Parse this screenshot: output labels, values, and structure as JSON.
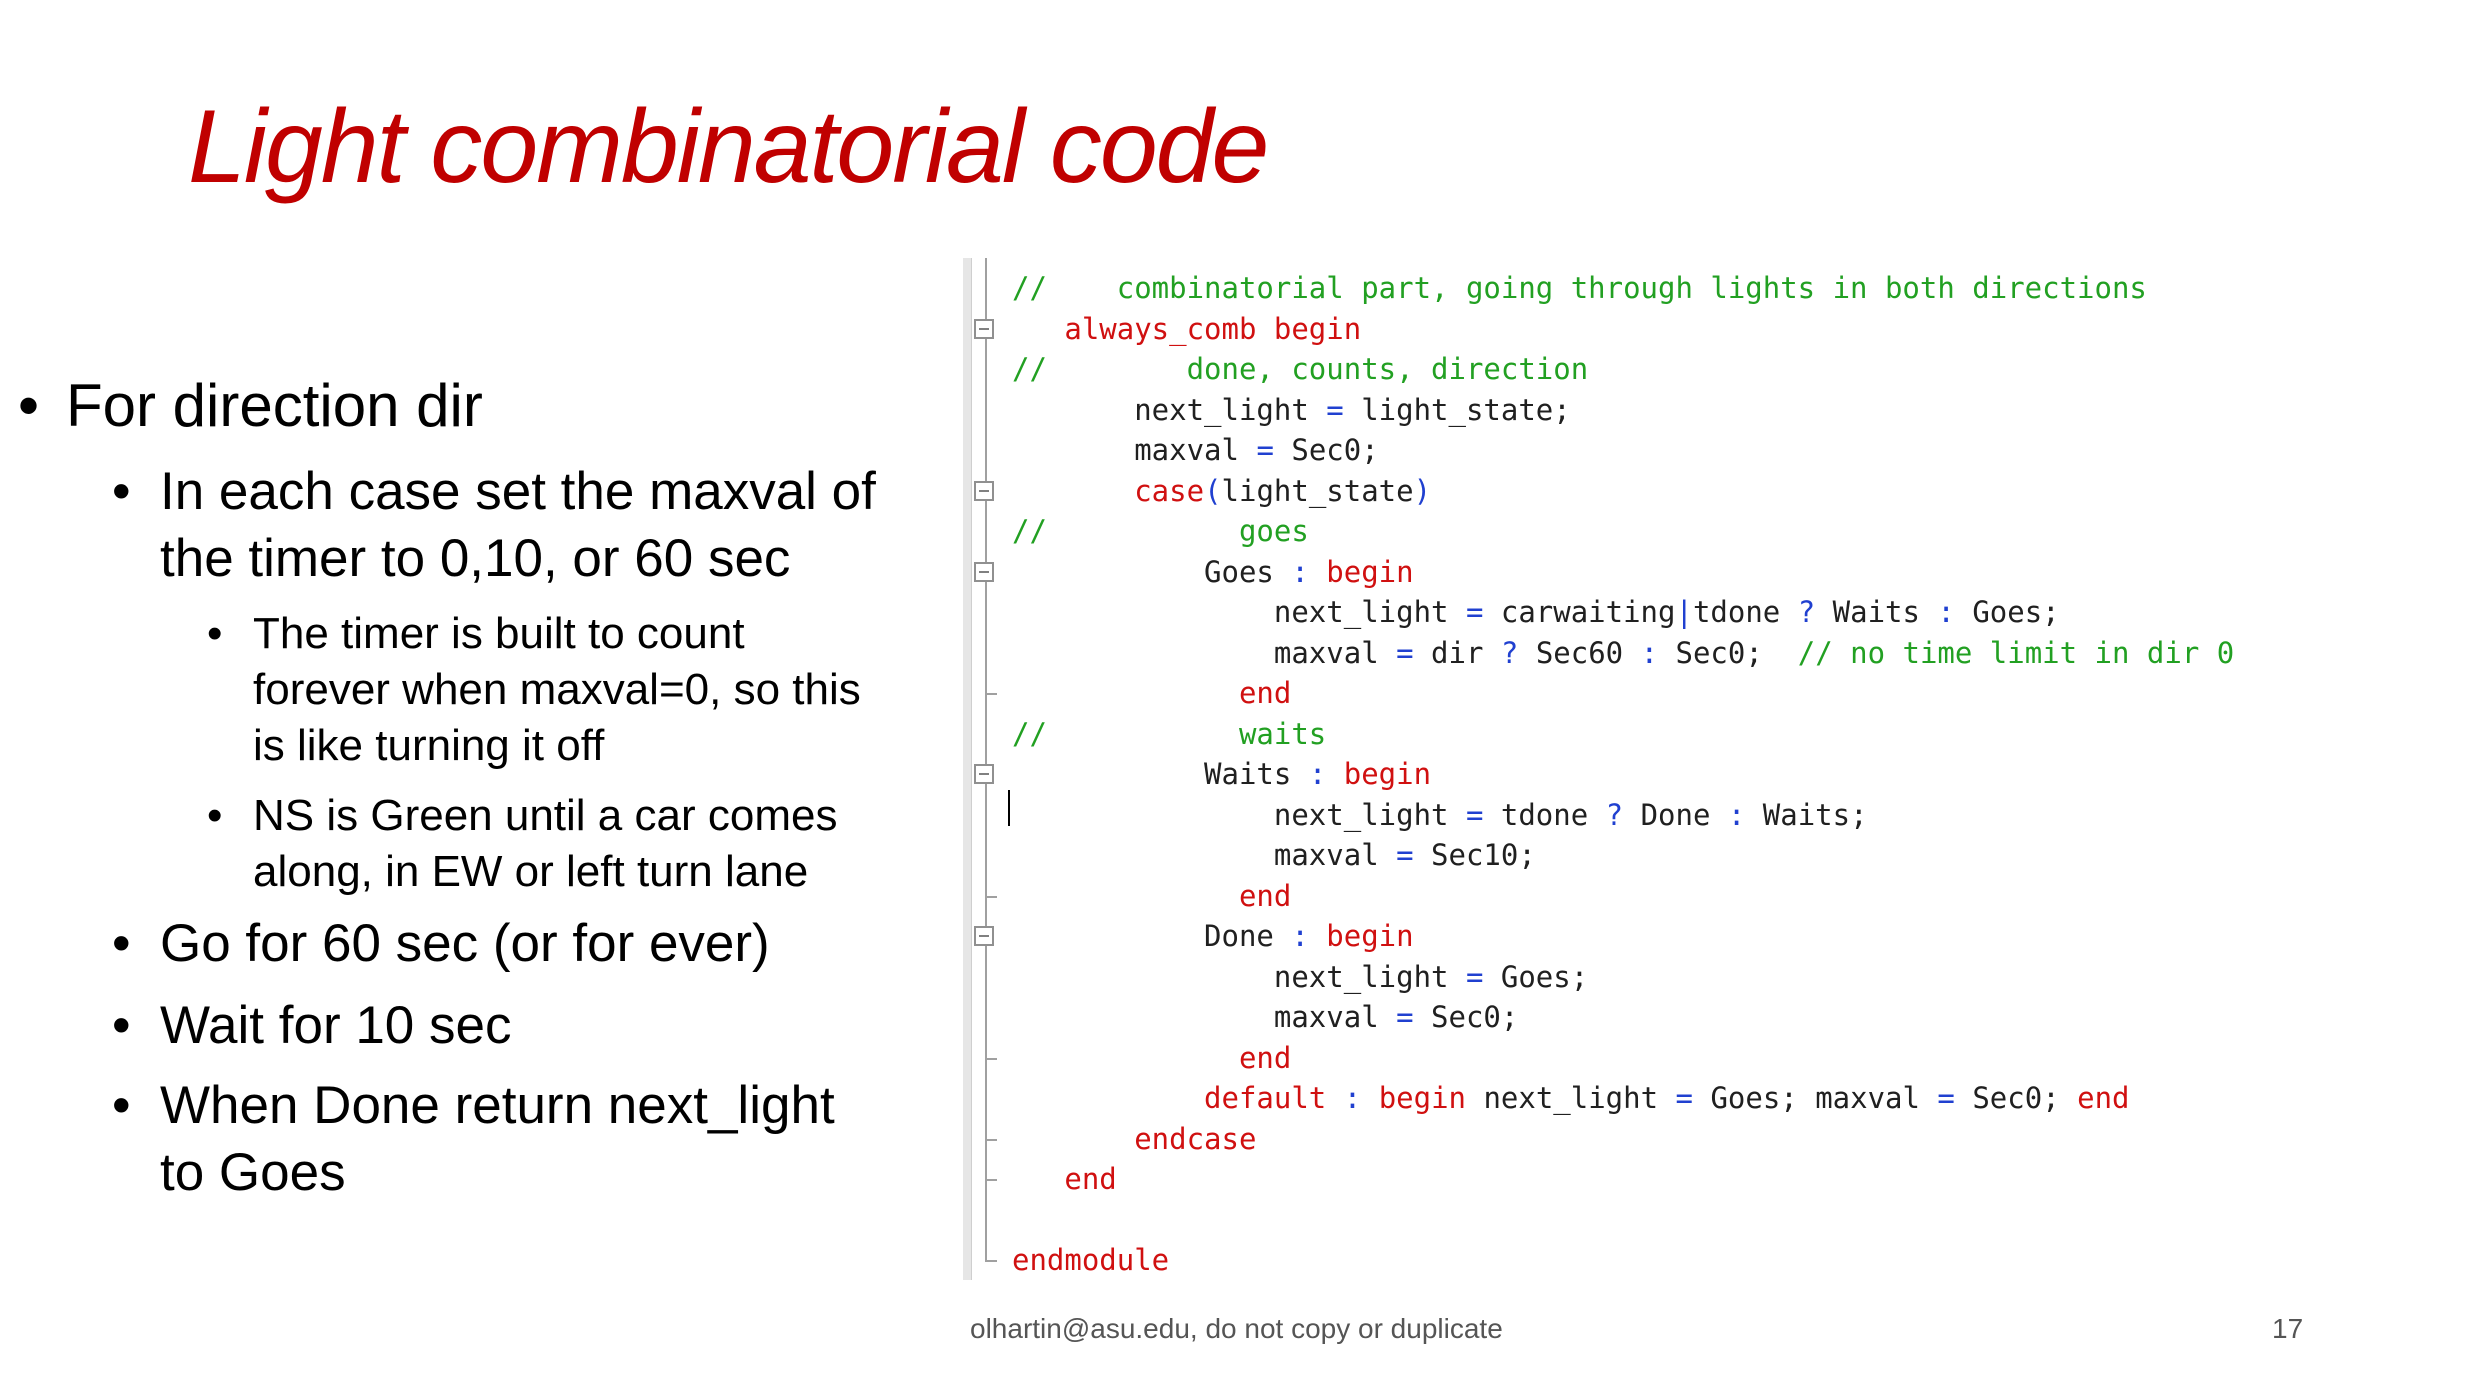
{
  "title": "Light combinatorial code",
  "bullets": [
    {
      "level": 1,
      "lines": [
        "For direction dir"
      ]
    },
    {
      "level": 2,
      "lines": [
        "In each case set the maxval of",
        "the timer to 0,10, or 60 sec"
      ]
    },
    {
      "level": 3,
      "lines": [
        "The timer is built to count",
        "forever when maxval=0, so this",
        "is like turning it off"
      ]
    },
    {
      "level": 3,
      "lines": [
        "NS is Green until a car comes",
        "along, in EW or left turn lane"
      ]
    },
    {
      "level": 2,
      "lines": [
        "Go for 60 sec (or for ever)"
      ]
    },
    {
      "level": 2,
      "lines": [
        "Wait for 10 sec"
      ]
    },
    {
      "level": 2,
      "lines": [
        "When Done return next_light",
        "to Goes"
      ]
    }
  ],
  "code_lines": [
    [
      [
        "cm",
        "//    combinatorial part, going through lights in both directions"
      ]
    ],
    [
      [
        "kw",
        "   always_comb begin"
      ]
    ],
    [
      [
        "cm",
        "//        done, counts, direction"
      ]
    ],
    [
      [
        "tx",
        "       next_light "
      ],
      [
        "op",
        "="
      ],
      [
        "tx",
        " light_state;"
      ]
    ],
    [
      [
        "tx",
        "       maxval "
      ],
      [
        "op",
        "="
      ],
      [
        "tx",
        " Sec0;"
      ]
    ],
    [
      [
        "kw",
        "       case"
      ],
      [
        "op",
        "("
      ],
      [
        "tx",
        "light_state"
      ],
      [
        "op",
        ")"
      ]
    ],
    [
      [
        "cm",
        "//           goes"
      ]
    ],
    [
      [
        "tx",
        "           Goes "
      ],
      [
        "op",
        ":"
      ],
      [
        "tx",
        " "
      ],
      [
        "kw",
        "begin"
      ]
    ],
    [
      [
        "tx",
        "               next_light "
      ],
      [
        "op",
        "="
      ],
      [
        "tx",
        " carwaiting"
      ],
      [
        "op",
        "|"
      ],
      [
        "tx",
        "tdone "
      ],
      [
        "op",
        "?"
      ],
      [
        "tx",
        " Waits "
      ],
      [
        "op",
        ":"
      ],
      [
        "tx",
        " Goes;"
      ]
    ],
    [
      [
        "tx",
        "               maxval "
      ],
      [
        "op",
        "="
      ],
      [
        "tx",
        " dir "
      ],
      [
        "op",
        "?"
      ],
      [
        "tx",
        " Sec60 "
      ],
      [
        "op",
        ":"
      ],
      [
        "tx",
        " Sec0;  "
      ],
      [
        "cm",
        "// no time limit in dir 0"
      ]
    ],
    [
      [
        "kw",
        "             end"
      ]
    ],
    [
      [
        "cm",
        "//           waits"
      ]
    ],
    [
      [
        "tx",
        "           Waits "
      ],
      [
        "op",
        ":"
      ],
      [
        "tx",
        " "
      ],
      [
        "kw",
        "begin"
      ]
    ],
    [
      [
        "tx",
        "               next_light "
      ],
      [
        "op",
        "="
      ],
      [
        "tx",
        " tdone "
      ],
      [
        "op",
        "?"
      ],
      [
        "tx",
        " Done "
      ],
      [
        "op",
        ":"
      ],
      [
        "tx",
        " Waits;"
      ]
    ],
    [
      [
        "tx",
        "               maxval "
      ],
      [
        "op",
        "="
      ],
      [
        "tx",
        " Sec10;"
      ]
    ],
    [
      [
        "kw",
        "             end"
      ]
    ],
    [
      [
        "tx",
        "           Done "
      ],
      [
        "op",
        ":"
      ],
      [
        "tx",
        " "
      ],
      [
        "kw",
        "begin"
      ]
    ],
    [
      [
        "tx",
        "               next_light "
      ],
      [
        "op",
        "="
      ],
      [
        "tx",
        " Goes;"
      ]
    ],
    [
      [
        "tx",
        "               maxval "
      ],
      [
        "op",
        "="
      ],
      [
        "tx",
        " Sec0;"
      ]
    ],
    [
      [
        "kw",
        "             end"
      ]
    ],
    [
      [
        "kw",
        "           default"
      ],
      [
        "tx",
        " "
      ],
      [
        "op",
        ":"
      ],
      [
        "tx",
        " "
      ],
      [
        "kw",
        "begin"
      ],
      [
        "tx",
        " next_light "
      ],
      [
        "op",
        "="
      ],
      [
        "tx",
        " Goes; maxval "
      ],
      [
        "op",
        "="
      ],
      [
        "tx",
        " Sec0; "
      ],
      [
        "kw",
        "end"
      ]
    ],
    [
      [
        "kw",
        "       endcase"
      ]
    ],
    [
      [
        "kw",
        "   end"
      ]
    ],
    [
      [
        "tx",
        ""
      ]
    ],
    [
      [
        "kw",
        "endmodule"
      ]
    ]
  ],
  "footer": {
    "text": "olhartin@asu.edu, do not copy or duplicate",
    "page_number": "17"
  }
}
